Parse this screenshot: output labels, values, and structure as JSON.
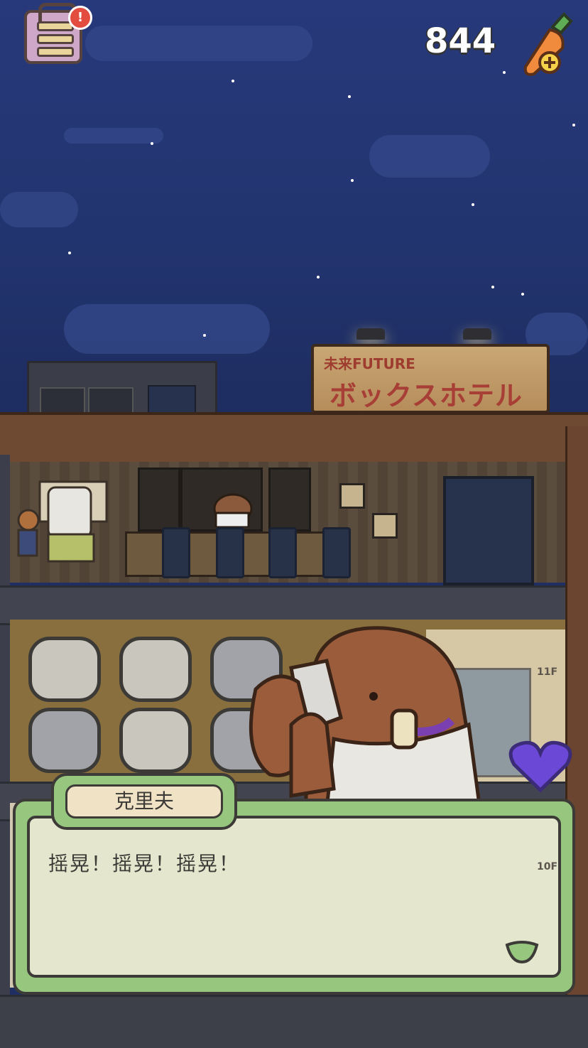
{
  "hud": {
    "carrot_count": "844",
    "menu_badge": "!"
  },
  "hotel_sign": {
    "line1": "未来FUTURE",
    "line2": "ボックスホテル"
  },
  "floors": {
    "capsule": "11F",
    "lockers": "10F"
  },
  "dialog": {
    "speaker": "克里夫",
    "text": "摇晃！摇晃！摇晃！"
  },
  "colors": {
    "sky": "#22346f",
    "dialog_frame": "#97c77f",
    "heart": "#6b49d6",
    "carrot": "#f08a3c"
  }
}
